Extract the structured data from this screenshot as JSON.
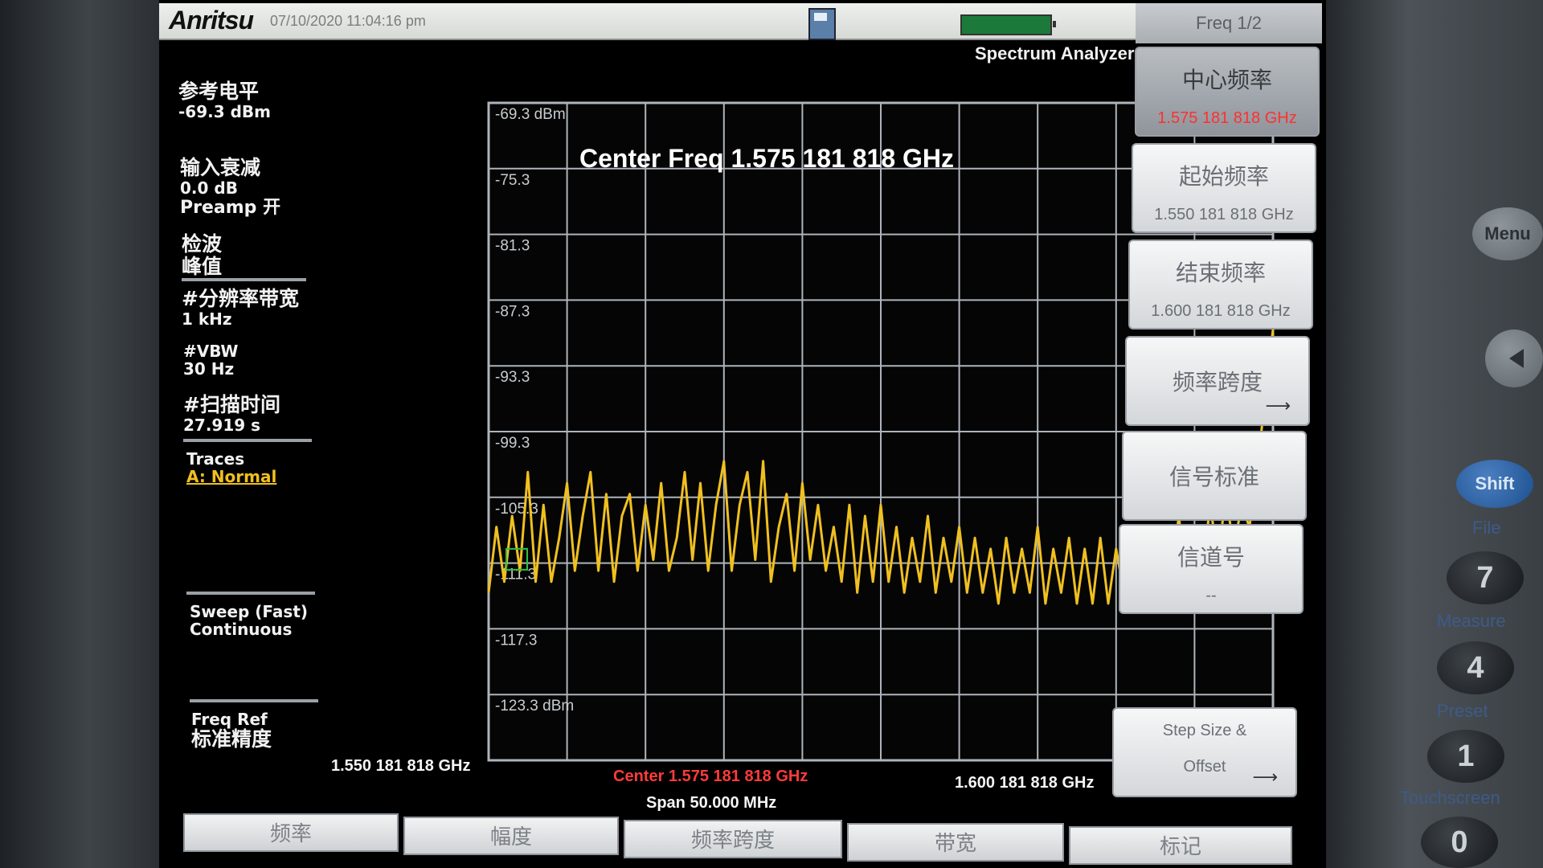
{
  "topbar": {
    "brand": "Anritsu",
    "datetime": "07/10/2020 11:04:16 pm",
    "mode": "Spectrum Analyzer",
    "icons": [
      "disk-icon",
      "battery-icon"
    ]
  },
  "left_panel": {
    "ref_level_label": "参考电平",
    "ref_level_value": "-69.3 dBm",
    "atten_label": "输入衰减",
    "atten_value": "0.0 dB",
    "preamp": "Preamp 开",
    "detector_label": "检波",
    "detector_value": "峰值",
    "rbw_label": "#分辨率带宽",
    "rbw_value": "1 kHz",
    "vbw_label": "#VBW",
    "vbw_value": "30 Hz",
    "sweep_time_label": "#扫描时间",
    "sweep_time_value": "27.919 s",
    "traces_label": "Traces",
    "trace_value": "A: Normal",
    "sweep_mode": "Sweep (Fast)",
    "sweep_cont": "Continuous",
    "freq_ref_label": "Freq Ref",
    "freq_ref_value": "标准精度"
  },
  "graph": {
    "center_freq_title": "Center Freq 1.575 181 818 GHz",
    "start_freq": "1.550 181 818 GHz",
    "center_label": "Center 1.575 181 818 GHz",
    "stop_freq": "1.600 181 818 GHz",
    "span_label": "Span 50.000 MHz",
    "y_ticks": [
      "-69.3 dBm",
      "-75.3",
      "-81.3",
      "-87.3",
      "-93.3",
      "-99.3",
      "-105.3",
      "-111.3",
      "-117.3",
      "-123.3 dBm"
    ],
    "trace_color": "#f0c020",
    "grid_color": "#aeb4bb"
  },
  "softkeys": {
    "header": "Freq 1/2",
    "items": [
      {
        "label": "中心频率",
        "value": "1.575 181 818 GHz"
      },
      {
        "label": "起始频率",
        "value": "1.550 181 818 GHz"
      },
      {
        "label": "结束频率",
        "value": "1.600 181 818 GHz"
      },
      {
        "label": "频率跨度",
        "value": ""
      },
      {
        "label": "信号标准",
        "value": ""
      },
      {
        "label": "信道号",
        "value": "--"
      },
      {
        "label": "Step Size &",
        "value": "Offset"
      }
    ]
  },
  "tabs": [
    "频率",
    "幅度",
    "频率跨度",
    "带宽",
    "标记"
  ],
  "hardware": {
    "menu": "Menu",
    "shift": "Shift",
    "file": "File",
    "key7": "7",
    "measure": "Measure",
    "key4": "4",
    "preset": "Preset",
    "key1": "1",
    "touchscreen": "Touchscreen",
    "key0": "0"
  },
  "chart_data": {
    "type": "line",
    "xlim": [
      1550.181818,
      1600.181818
    ],
    "ylim": [
      -129.3,
      -69.3
    ],
    "xlabel": "",
    "ylabel": "",
    "grid": true,
    "series": [
      {
        "values_x": [
          1550.18,
          1550.68,
          1551.18,
          1551.68,
          1552.18,
          1552.68,
          1553.18,
          1553.68,
          1554.18,
          1554.68,
          1555.18,
          1555.68,
          1556.18,
          1556.68,
          1557.18,
          1557.68,
          1558.18,
          1558.68,
          1559.18,
          1559.68,
          1560.18,
          1560.68,
          1561.18,
          1561.68,
          1562.18,
          1562.68,
          1563.18,
          1563.68,
          1564.18,
          1564.68,
          1565.18,
          1565.68,
          1566.18,
          1566.68,
          1567.18,
          1567.68,
          1568.18,
          1568.68,
          1569.18,
          1569.68,
          1570.18,
          1570.68,
          1571.18,
          1571.68,
          1572.18,
          1572.68,
          1573.18,
          1573.68,
          1574.18,
          1574.68,
          1575.18,
          1575.68,
          1576.18,
          1576.68,
          1577.18,
          1577.68,
          1578.18,
          1578.68,
          1579.18,
          1579.68,
          1580.18,
          1580.68,
          1581.18,
          1581.68,
          1582.18,
          1582.68,
          1583.18,
          1583.68,
          1584.18,
          1584.68,
          1585.18,
          1585.68,
          1586.18,
          1586.68,
          1587.18,
          1587.68,
          1588.18,
          1588.68,
          1589.18,
          1589.68,
          1590.18,
          1590.68,
          1591.18,
          1591.68,
          1592.18,
          1592.68,
          1593.18,
          1593.68,
          1594.18,
          1594.68,
          1595.18,
          1595.68,
          1596.18,
          1596.68,
          1597.18,
          1597.68,
          1598.18,
          1598.68,
          1599.18,
          1599.68,
          1600.18
        ],
        "values_y": [
          -114,
          -108,
          -113,
          -107,
          -112,
          -103,
          -113,
          -106,
          -113,
          -109,
          -104,
          -112,
          -107,
          -103,
          -112,
          -105,
          -113,
          -107,
          -105,
          -112,
          -106,
          -111,
          -104,
          -112,
          -109,
          -103,
          -111,
          -104,
          -112,
          -106,
          -102,
          -112,
          -106,
          -103,
          -111,
          -102,
          -113,
          -108,
          -105,
          -112,
          -104,
          -111,
          -106,
          -112,
          -108,
          -113,
          -106,
          -114,
          -107,
          -113,
          -106,
          -113,
          -108,
          -114,
          -109,
          -113,
          -107,
          -114,
          -109,
          -113,
          -108,
          -114,
          -109,
          -114,
          -110,
          -115,
          -109,
          -114,
          -110,
          -114,
          -108,
          -115,
          -110,
          -114,
          -109,
          -115,
          -110,
          -115,
          -109,
          -115,
          -110,
          -114,
          -108,
          -114,
          -109,
          -114,
          -108,
          -113,
          -107,
          -113,
          -108,
          -112,
          -106,
          -111,
          -105,
          -110,
          -106,
          -108,
          -103,
          -96,
          -90
        ]
      }
    ]
  }
}
